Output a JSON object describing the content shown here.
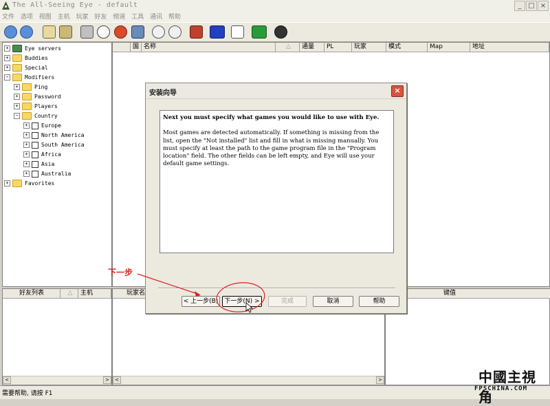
{
  "window": {
    "title": "The All-Seeing Eye - default"
  },
  "menu": [
    "文件",
    "选项",
    "视图",
    "主机",
    "玩家",
    "好友",
    "频道",
    "工具",
    "通讯",
    "帮助"
  ],
  "tree": {
    "items": [
      {
        "label": "Eye servers"
      },
      {
        "label": "Buddies"
      },
      {
        "label": "Special"
      },
      {
        "label": "Modifiers"
      },
      {
        "label": "Ping"
      },
      {
        "label": "Password"
      },
      {
        "label": "Players"
      },
      {
        "label": "Country"
      },
      {
        "label": "Europe"
      },
      {
        "label": "North America"
      },
      {
        "label": "South America"
      },
      {
        "label": "Africa"
      },
      {
        "label": "Asia"
      },
      {
        "label": "Australia"
      },
      {
        "label": "Favorites"
      }
    ]
  },
  "server_columns": [
    "国",
    "名称",
    "△",
    "通量",
    "PL",
    "玩家",
    "模式",
    "Map",
    "地址"
  ],
  "friends_columns": [
    "好友列表",
    "△",
    "主机"
  ],
  "players_columns": [
    "玩家名"
  ],
  "rules_columns": [
    "键值"
  ],
  "status": "需要帮助, 请按 F1",
  "dialog": {
    "title": "安装向导",
    "lead": "Next you must specify what games you would like to use with Eye.",
    "body": "Most games are detected automatically. If something is missing from the list, open the \"Not installed\" list and fill in what is missing manually. You must specify at least the path to the game program file in the \"Program location\" field. The other fields can be left empty, and Eye will use your default game settings.",
    "buttons": {
      "back": "< 上一步(B)",
      "next": "下一步(N) >",
      "finish": "完成",
      "cancel": "取消",
      "help": "帮助"
    }
  },
  "annotation": {
    "label": "下一步"
  },
  "watermark": {
    "text": "中國主視角",
    "sub": "FPSCHINA.COM"
  },
  "colors": {
    "annotation": "#e02020",
    "close": "#d9533c",
    "folder": "#f6d767"
  }
}
